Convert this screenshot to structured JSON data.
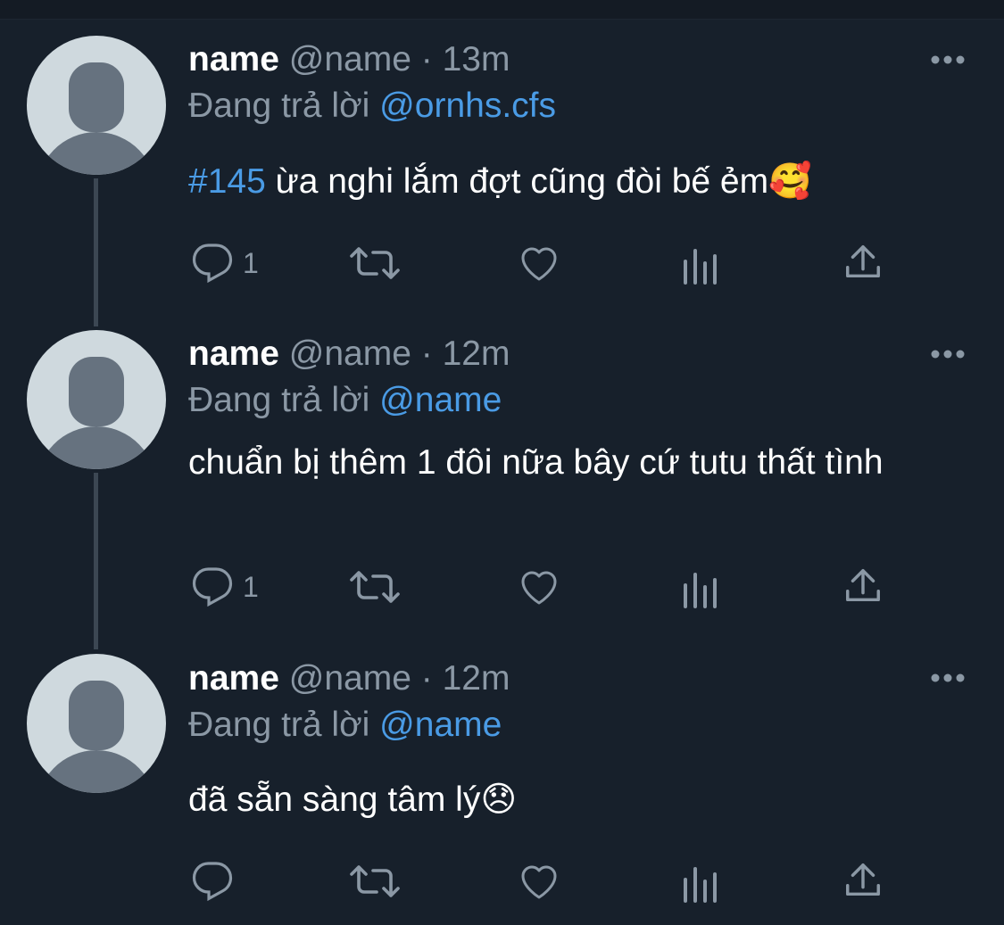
{
  "colors": {
    "background": "#17202b",
    "text_primary": "#ffffff",
    "text_secondary": "#8b98a5",
    "link": "#4a9be5",
    "thread_line": "#3c4753"
  },
  "tweets": [
    {
      "display_name": "name",
      "handle": "@name",
      "separator": "·",
      "time": "13m",
      "replying_label": "Đang trả lời",
      "replying_to": "@ornhs.cfs",
      "hashtag": "#145",
      "text": " ừa nghi lắm đợt cũng đòi bế ẻm",
      "emoji": "🥰",
      "reply_count": "1",
      "icons": [
        "reply-icon",
        "retweet-icon",
        "like-icon",
        "views-icon",
        "share-icon",
        "more-icon"
      ]
    },
    {
      "display_name": "name",
      "handle": "@name",
      "separator": "·",
      "time": "12m",
      "replying_label": "Đang trả lời",
      "replying_to": "@name",
      "text": "chuẩn bị thêm 1 đôi nữa bây cứ tutu thất tình",
      "reply_count": "1",
      "icons": [
        "reply-icon",
        "retweet-icon",
        "like-icon",
        "views-icon",
        "share-icon",
        "more-icon"
      ]
    },
    {
      "display_name": "name",
      "handle": "@name",
      "separator": "·",
      "time": "12m",
      "replying_label": "Đang trả lời",
      "replying_to": "@name",
      "text": "đã sẵn sàng tâm lý",
      "emoji": "😞",
      "reply_count": "",
      "icons": [
        "reply-icon",
        "retweet-icon",
        "like-icon",
        "views-icon",
        "share-icon",
        "more-icon"
      ]
    }
  ]
}
